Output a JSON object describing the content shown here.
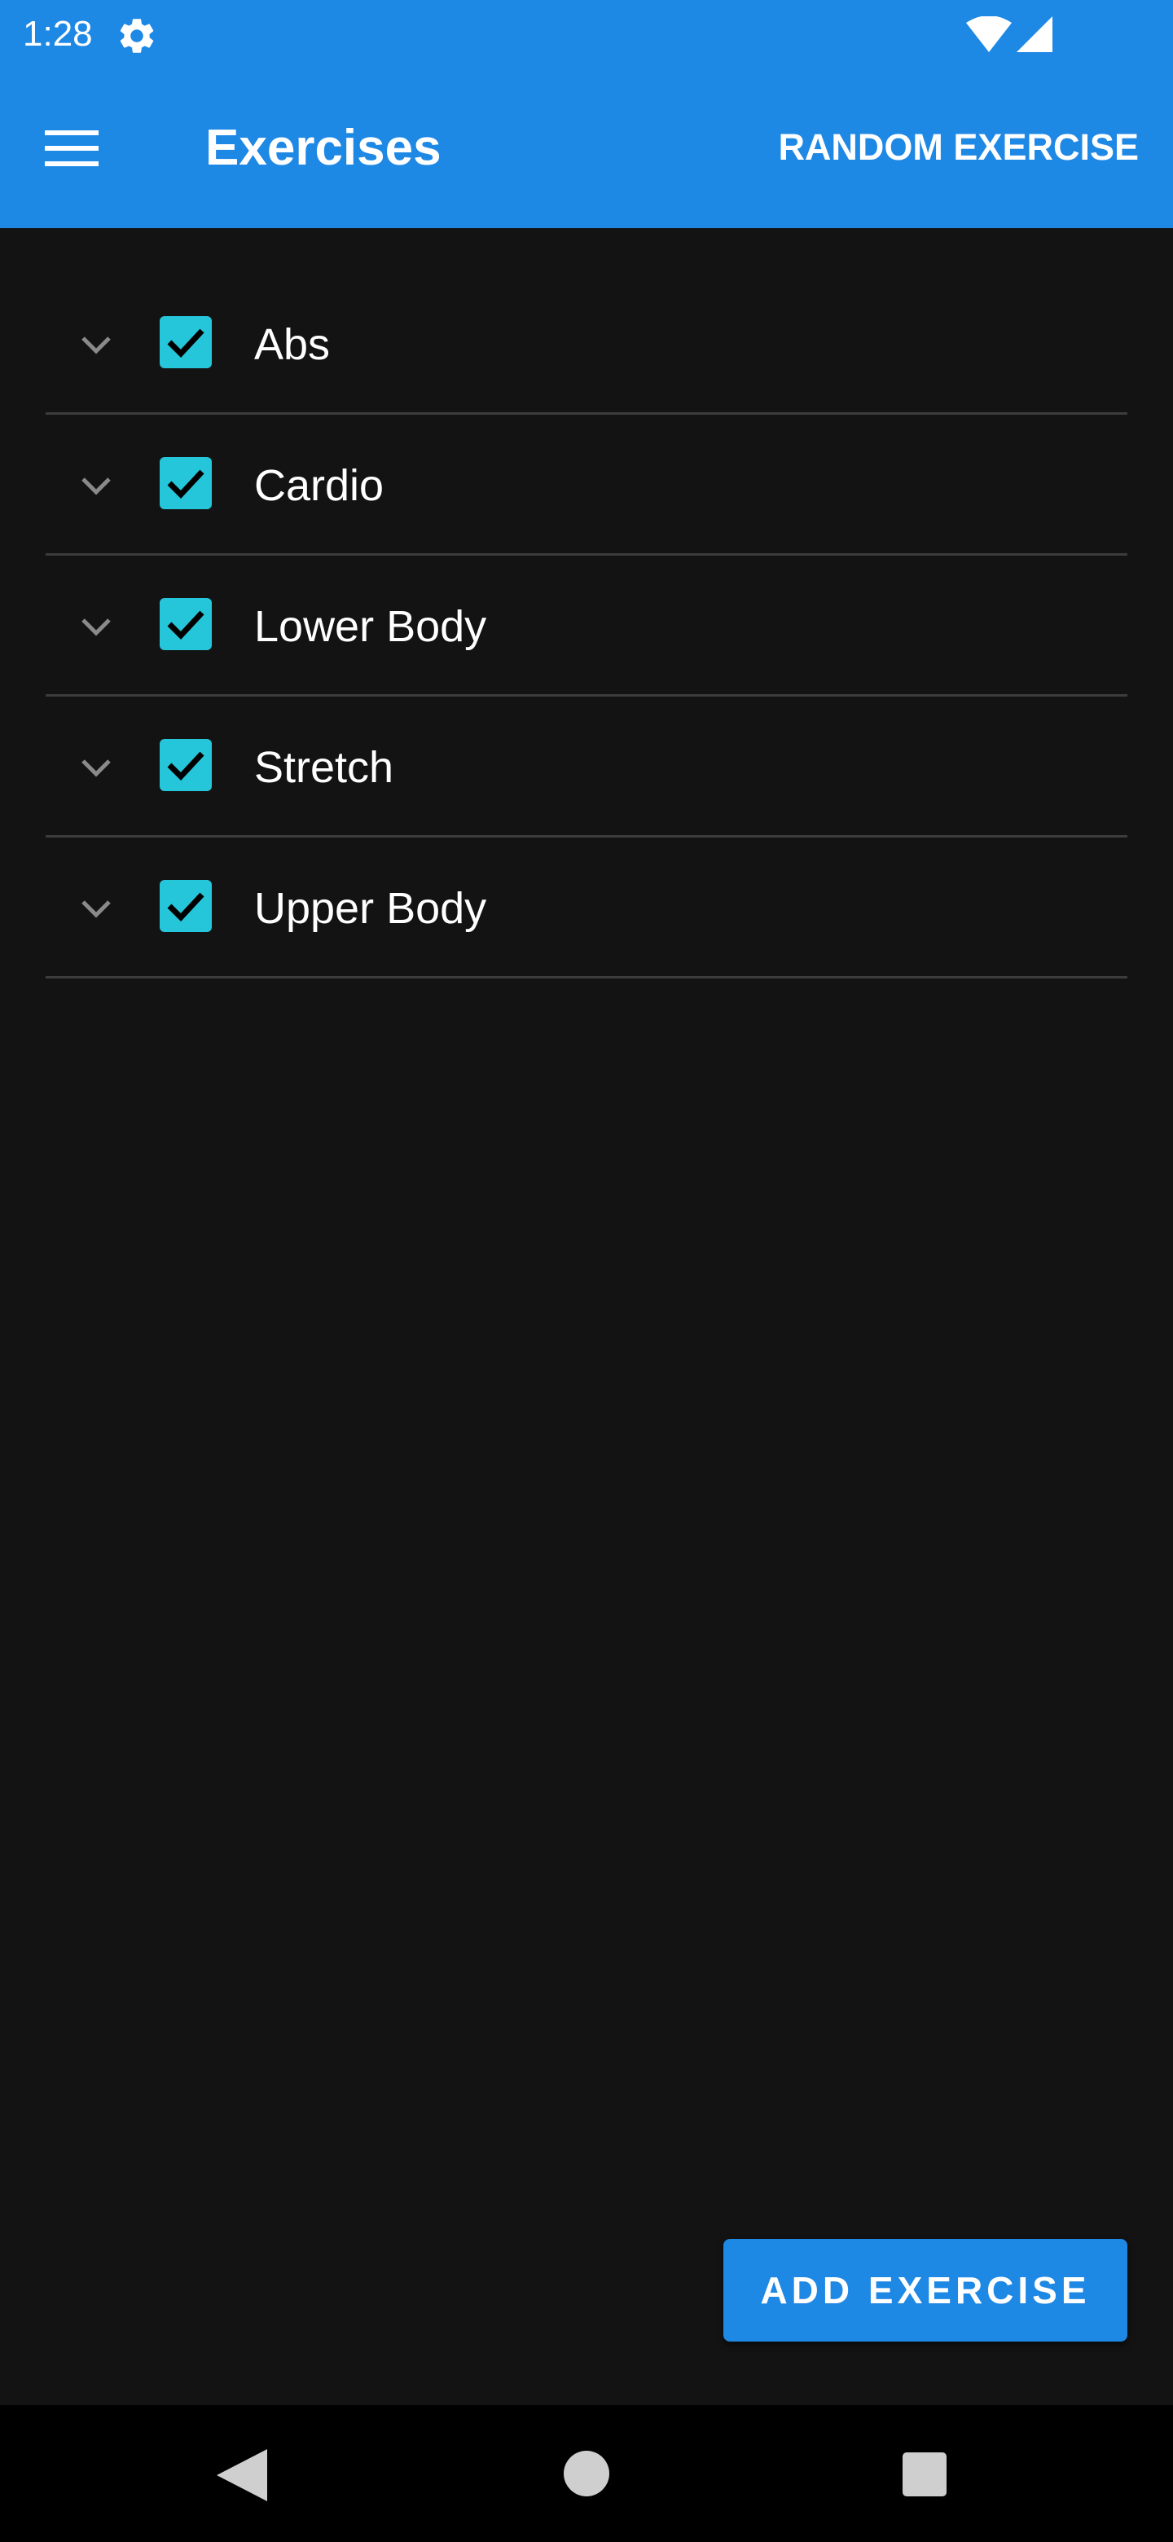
{
  "status_bar": {
    "time": "1:28",
    "icons": [
      "gear-icon",
      "wifi-icon",
      "cell-signal-icon"
    ]
  },
  "app_bar": {
    "menu_icon": "hamburger-menu-icon",
    "title": "Exercises",
    "random_button_label": "RANDOM EXERCISE",
    "color": "#1e88e5"
  },
  "categories": [
    {
      "label": "Abs",
      "checked": true,
      "icon": "chevron-down-icon"
    },
    {
      "label": "Cardio",
      "checked": true,
      "icon": "chevron-down-icon"
    },
    {
      "label": "Lower Body",
      "checked": true,
      "icon": "chevron-down-icon"
    },
    {
      "label": "Stretch",
      "checked": true,
      "icon": "chevron-down-icon"
    },
    {
      "label": "Upper Body",
      "checked": true,
      "icon": "chevron-down-icon"
    }
  ],
  "checkbox_color": "#26c6da",
  "add_button_label": "ADD EXERCISE",
  "nav_bar": {
    "icons": [
      "back-icon",
      "home-icon",
      "recents-icon"
    ]
  },
  "background_color": "#131313"
}
